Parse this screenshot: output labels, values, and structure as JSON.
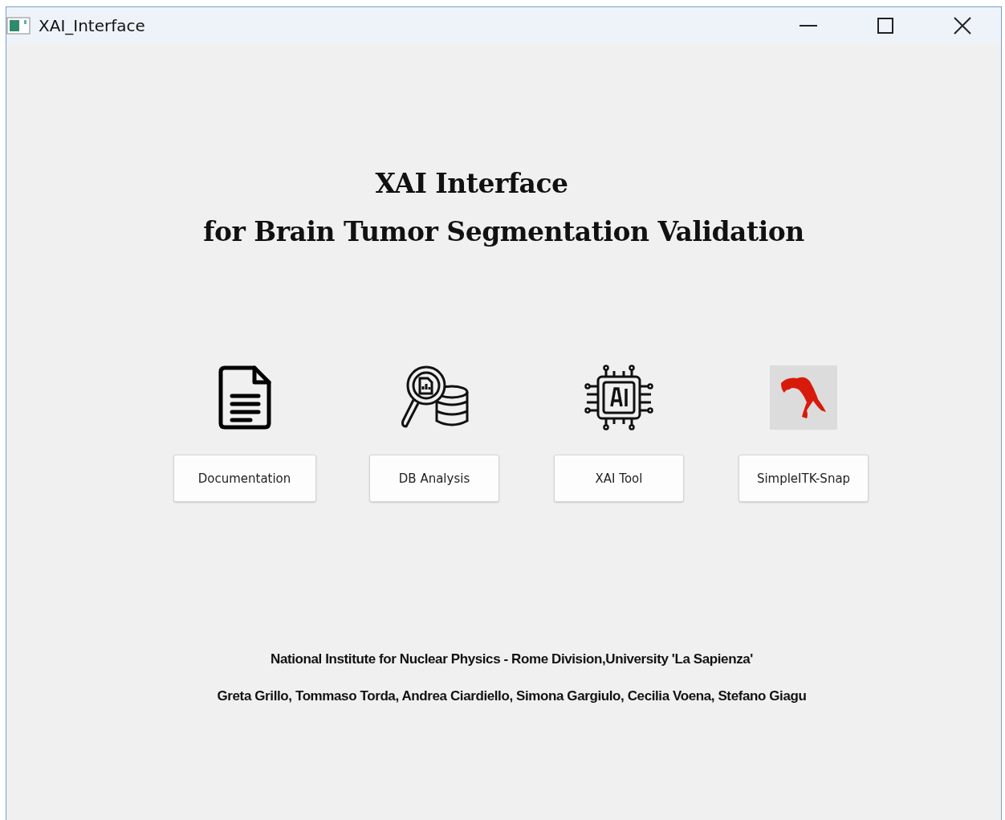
{
  "window": {
    "title": "XAI_Interface"
  },
  "heading": [
    "XAI Interface",
    "for Brain Tumor Segmentation Validation"
  ],
  "tools": [
    {
      "kind": "document",
      "label": "Documentation"
    },
    {
      "kind": "database",
      "label": "DB Analysis"
    },
    {
      "kind": "chip",
      "label": "XAI Tool"
    },
    {
      "kind": "logo",
      "label": "SimpleITK-Snap"
    }
  ],
  "footer": [
    "National Institute for Nuclear Physics - Rome Division,University 'La Sapienza'",
    "Greta Grillo, Tommaso Torda, Andrea Ciardiello, Simona Gargiulo, Cecilia Voena, Stefano Giagu"
  ]
}
